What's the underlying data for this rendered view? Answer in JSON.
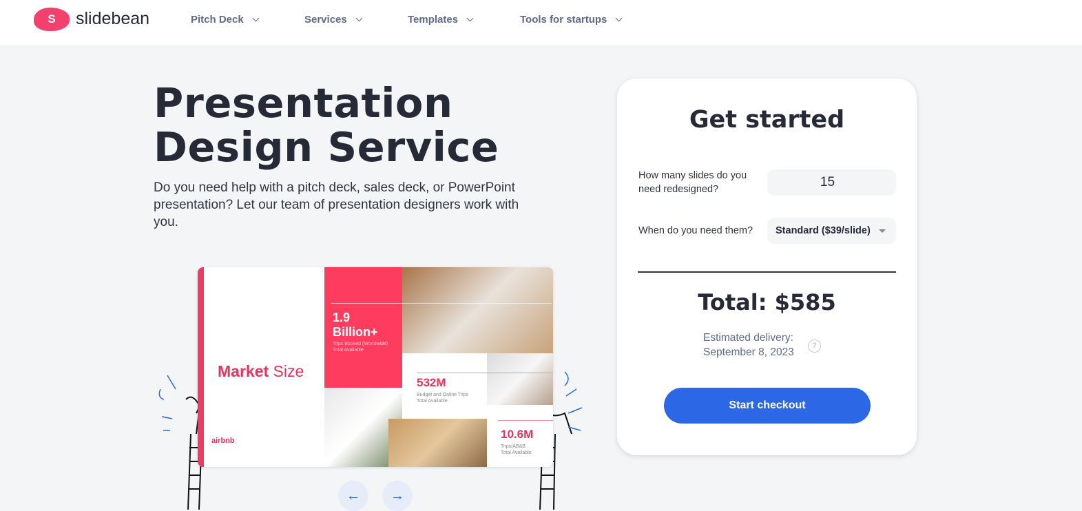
{
  "nav": {
    "logo_letter": "S",
    "logo_text": "slidebean",
    "items": [
      {
        "label": "Pitch Deck"
      },
      {
        "label": "Services"
      },
      {
        "label": "Templates"
      },
      {
        "label": "Tools for startups"
      }
    ]
  },
  "hero": {
    "title_line1": "Presentation",
    "title_line2": "Design Service",
    "subtitle": "Do you need help with a pitch deck, sales deck, or PowerPoint presentation? Let our team of presentation designers work with you."
  },
  "slide": {
    "title_bold": "Market",
    "title_rest": " Size",
    "brand": "airbnb",
    "stat1_line1": "1.9",
    "stat1_line2": "Billion+",
    "stat1_cap1": "Trips Booked (Worldwide)",
    "stat1_cap2": "Total Available",
    "stat2": "532M",
    "stat2_cap1": "Budget and Online Trips",
    "stat2_cap2": "Total Available",
    "stat3": "10.6M",
    "stat3_cap1": "Trips/AB&B",
    "stat3_cap2": "Total Available"
  },
  "carousel": {
    "prev": "←",
    "next": "→"
  },
  "form": {
    "title": "Get started",
    "slides_label": "How many slides do you need redesigned?",
    "slides_value": "15",
    "when_label": "When do you need them?",
    "when_value": "Standard ($39/slide)",
    "total": "Total: $585",
    "delivery_label": "Estimated delivery:",
    "delivery_date": "September 8, 2023",
    "help": "?",
    "checkout": "Start checkout"
  },
  "colors": {
    "brand": "#f4406c",
    "accent": "#2c68e5",
    "slide_red": "#fe3c60"
  }
}
